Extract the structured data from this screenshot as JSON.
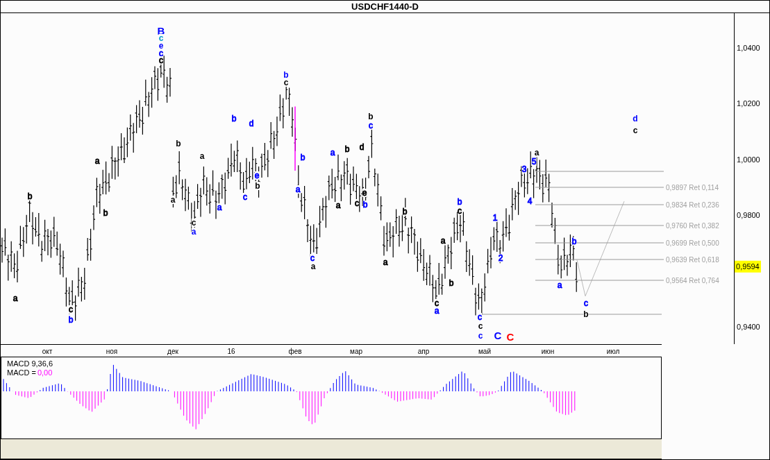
{
  "title": "USDCHF1440-D",
  "price_axis": {
    "labels": [
      "1,0400",
      "1,0200",
      "1,0000",
      "0,9800",
      "0,9400"
    ],
    "current_price": "0,9594"
  },
  "wave_labels": [
    {
      "text": "B",
      "color": "#0000ff",
      "kind": "major"
    },
    {
      "text": "c",
      "color": "#0099cc",
      "kind": "bold"
    },
    {
      "text": "e",
      "color": "#0000ff",
      "kind": "bold"
    },
    {
      "text": "c",
      "color": "#0000ff",
      "kind": "minor"
    },
    {
      "text": "c",
      "color": "#000000",
      "kind": "minor"
    },
    {
      "text": "b",
      "color": "#000000",
      "kind": "minor"
    },
    {
      "text": "a",
      "color": "#000000",
      "kind": "minor"
    },
    {
      "text": "a",
      "color": "#000000",
      "kind": "minor"
    },
    {
      "text": "b",
      "color": "#000000",
      "kind": "minor"
    },
    {
      "text": "c",
      "color": "#000000",
      "kind": "minor"
    },
    {
      "text": "b",
      "color": "#0000ff",
      "kind": "minor"
    },
    {
      "text": "b",
      "color": "#000000",
      "kind": "bold"
    },
    {
      "text": "a",
      "color": "#000000",
      "kind": "bold"
    },
    {
      "text": "a",
      "color": "#000000",
      "kind": "bold"
    },
    {
      "text": "c",
      "color": "#000000",
      "kind": "bold"
    },
    {
      "text": "a",
      "color": "#0000ff",
      "kind": "bold"
    },
    {
      "text": "a",
      "color": "#0000ff",
      "kind": "minor"
    },
    {
      "text": "b",
      "color": "#0000ff",
      "kind": "minor"
    },
    {
      "text": "c",
      "color": "#0000ff",
      "kind": "minor"
    },
    {
      "text": "d",
      "color": "#0000ff",
      "kind": "minor"
    },
    {
      "text": "e",
      "color": "#0000ff",
      "kind": "minor"
    },
    {
      "text": "b",
      "color": "#000000",
      "kind": "bold"
    },
    {
      "text": "b",
      "color": "#0000ff",
      "kind": "bold"
    },
    {
      "text": "c",
      "color": "#000000",
      "kind": "bold"
    },
    {
      "text": "b",
      "color": "#0000ff",
      "kind": "minor"
    },
    {
      "text": "a",
      "color": "#0000ff",
      "kind": "minor"
    },
    {
      "text": "c",
      "color": "#0000ff",
      "kind": "minor"
    },
    {
      "text": "a",
      "color": "#000000",
      "kind": "bold"
    },
    {
      "text": "a",
      "color": "#0000ff",
      "kind": "minor"
    },
    {
      "text": "b",
      "color": "#000000",
      "kind": "minor"
    },
    {
      "text": "a",
      "color": "#000000",
      "kind": "minor"
    },
    {
      "text": "d",
      "color": "#000000",
      "kind": "minor"
    },
    {
      "text": "e",
      "color": "#000000",
      "kind": "minor"
    },
    {
      "text": "c",
      "color": "#000000",
      "kind": "minor"
    },
    {
      "text": "b",
      "color": "#0000ff",
      "kind": "minor"
    },
    {
      "text": "b",
      "color": "#000000",
      "kind": "bold"
    },
    {
      "text": "c",
      "color": "#0000ff",
      "kind": "minor"
    },
    {
      "text": "a",
      "color": "#000000",
      "kind": "minor"
    },
    {
      "text": "b",
      "color": "#000000",
      "kind": "minor"
    },
    {
      "text": "b",
      "color": "#000000",
      "kind": "minor"
    },
    {
      "text": "a",
      "color": "#000000",
      "kind": "minor"
    },
    {
      "text": "c",
      "color": "#000000",
      "kind": "minor"
    },
    {
      "text": "a",
      "color": "#0000ff",
      "kind": "minor"
    },
    {
      "text": "b",
      "color": "#0000ff",
      "kind": "minor"
    },
    {
      "text": "c",
      "color": "#000000",
      "kind": "minor"
    },
    {
      "text": "c",
      "color": "#0000ff",
      "kind": "minor"
    },
    {
      "text": "c",
      "color": "#000000",
      "kind": "bold"
    },
    {
      "text": "c",
      "color": "#0000ff",
      "kind": "bold"
    },
    {
      "text": "C",
      "color": "#0000ff",
      "kind": "major"
    },
    {
      "text": "C",
      "color": "#ff0000",
      "kind": "major"
    },
    {
      "text": "1",
      "color": "#0000ff",
      "kind": "minor"
    },
    {
      "text": "2",
      "color": "#0000ff",
      "kind": "minor"
    },
    {
      "text": "3",
      "color": "#0000ff",
      "kind": "minor"
    },
    {
      "text": "4",
      "color": "#0000ff",
      "kind": "minor"
    },
    {
      "text": "5",
      "color": "#0000ff",
      "kind": "minor"
    },
    {
      "text": "a",
      "color": "#000000",
      "kind": "bold"
    },
    {
      "text": "a",
      "color": "#0000ff",
      "kind": "minor"
    },
    {
      "text": "b",
      "color": "#0000ff",
      "kind": "minor"
    },
    {
      "text": "c",
      "color": "#0000ff",
      "kind": "minor"
    },
    {
      "text": "b",
      "color": "#000000",
      "kind": "bold"
    },
    {
      "text": "d",
      "color": "#0000ff",
      "kind": "bold"
    },
    {
      "text": "c",
      "color": "#000000",
      "kind": "bold"
    }
  ],
  "fib_levels": [
    {
      "label": "0,9897 Ret 0,114"
    },
    {
      "label": "0,9834 Ret 0,236"
    },
    {
      "label": "0,9760 Ret 0,382"
    },
    {
      "label": "0,9699 Ret 0,500"
    },
    {
      "label": "0,9639 Ret 0,618"
    },
    {
      "label": "0,9564 Ret 0,764"
    }
  ],
  "date_axis": [
    "окт",
    "ноя",
    "дек",
    "16",
    "фев",
    "мар",
    "апр",
    "май",
    "июн",
    "июл"
  ],
  "macd": {
    "title": "MACD 9,36,6",
    "value_label": "MACD =",
    "value": "0,00"
  }
}
